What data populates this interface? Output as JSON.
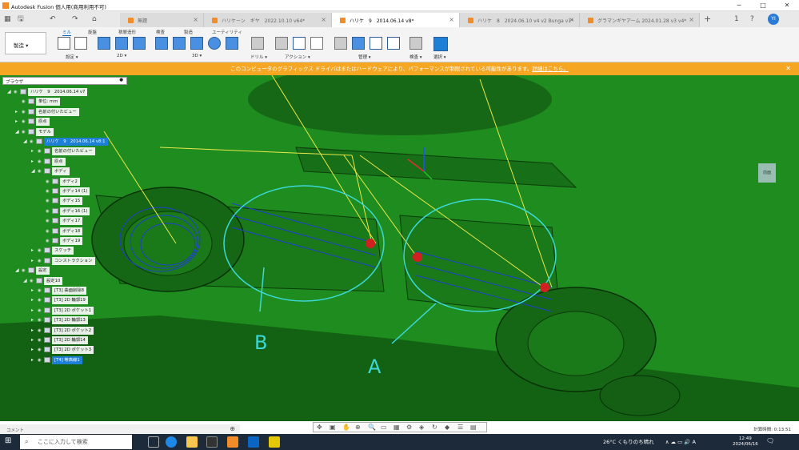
{
  "titlebar": {
    "title": "Autodesk Fusion 個人用(商用利用不可)",
    "minimize": "─",
    "maximize": "□",
    "close": "✕"
  },
  "tabs": [
    {
      "label": "無題"
    },
    {
      "label": "ハリケーン　ギヤ　2022.10.10 v64*"
    },
    {
      "label": "ハリケ　9　2014.06.14 v8*"
    },
    {
      "label": "ハリケ　8　2024.06.10 v4 v2 Bunga v1*"
    },
    {
      "label": "グラマンギヤアーム 2024.01.28 v3 v4*"
    }
  ],
  "tabbar": {
    "grid": "▦",
    "save": "🖫",
    "undo": "↶",
    "redo": "↷",
    "home": "⌂",
    "new_tab": "+",
    "user": "YI",
    "help": "?",
    "notif": "1"
  },
  "toolbar": {
    "workspace": "製造 ▾",
    "tabs": [
      "ミル",
      "旋盤",
      "積層造形",
      "検査",
      "製造",
      "ユーティリティ"
    ],
    "groups": [
      "設定 ▾",
      "2D ▾",
      "3D ▾",
      "ドリル ▾",
      "アクション ▾",
      "管理 ▾",
      "検査 ▾",
      "選択 ▾"
    ]
  },
  "warning": {
    "text": "このコンピュータのグラフィックス ドライバはまたはハードウェアにより、パフォーマンスが制限されている可能性があります。",
    "link": "詳細はこちら。",
    "close": "✕"
  },
  "browser": {
    "header": "ブラウザ",
    "rows": [
      {
        "label": "ハリケ　9　2014.06.14 v7",
        "indent": 0,
        "exp": "◢"
      },
      {
        "label": "単位: mm",
        "indent": 1,
        "exp": ""
      },
      {
        "label": "名前の付いたビュー",
        "indent": 1,
        "exp": "▸"
      },
      {
        "label": "原点",
        "indent": 1,
        "exp": "▸"
      },
      {
        "label": "モデル",
        "indent": 1,
        "exp": "◢"
      },
      {
        "label": "ハリケ　9　2014.06.14 v8:1",
        "indent": 2,
        "exp": "◢",
        "sel": true
      },
      {
        "label": "名前の付いたビュー",
        "indent": 3,
        "exp": "▸"
      },
      {
        "label": "原点",
        "indent": 3,
        "exp": "▸"
      },
      {
        "label": "ボディ",
        "indent": 3,
        "exp": "◢"
      },
      {
        "label": "ボディ2",
        "indent": 4,
        "exp": ""
      },
      {
        "label": "ボディ14 (1)",
        "indent": 4,
        "exp": ""
      },
      {
        "label": "ボディ15",
        "indent": 4,
        "exp": ""
      },
      {
        "label": "ボディ16 (1)",
        "indent": 4,
        "exp": ""
      },
      {
        "label": "ボディ17",
        "indent": 4,
        "exp": ""
      },
      {
        "label": "ボディ18",
        "indent": 4,
        "exp": ""
      },
      {
        "label": "ボディ19",
        "indent": 4,
        "exp": ""
      },
      {
        "label": "スケッチ",
        "indent": 3,
        "exp": "▸"
      },
      {
        "label": "コンストラクション",
        "indent": 3,
        "exp": "▸"
      },
      {
        "label": "設定",
        "indent": 1,
        "exp": "◢"
      },
      {
        "label": "設定10",
        "indent": 2,
        "exp": "◢"
      },
      {
        "label": "[T3] 曲面削除8",
        "indent": 3,
        "exp": "▸"
      },
      {
        "label": "[T3] 2D 輪郭19",
        "indent": 3,
        "exp": "▸"
      },
      {
        "label": "[T3] 2D ポケット1",
        "indent": 3,
        "exp": "▸"
      },
      {
        "label": "[T3] 2D 輪郭13",
        "indent": 3,
        "exp": "▸"
      },
      {
        "label": "[T3] 2D ポケット2",
        "indent": 3,
        "exp": "▸"
      },
      {
        "label": "[T3] 2D 輪郭14",
        "indent": 3,
        "exp": "▸"
      },
      {
        "label": "[T3] 2D ポケット3",
        "indent": 3,
        "exp": "▸"
      },
      {
        "label": "[T4] 等高線1",
        "indent": 3,
        "exp": "▸",
        "sel": true
      }
    ]
  },
  "viewport": {
    "label_a": "A",
    "label_b": "B",
    "cube_label": "前面"
  },
  "navbar": {
    "icons": [
      "✥",
      "▣",
      "✋",
      "⊕",
      "🔍",
      "▭",
      "▦",
      "⚙",
      "◈",
      "↻",
      "◆",
      "☰",
      "▤"
    ]
  },
  "comment": {
    "label": "コメント",
    "add": "⊕"
  },
  "status": {
    "text": "計算時間: 0:13:51"
  },
  "taskbar": {
    "start": "⊞",
    "search": "ここに入力して検索",
    "search_icon": "⌕",
    "weather": "26°C くもりのち晴れ",
    "time": "12:49",
    "date": "2024/06/16",
    "tray": "∧ ☁ ▭ 🔊 A",
    "notifications": "🗨"
  },
  "colors": {
    "brand": "#f28c28",
    "warning": "#f5a623",
    "select": "#1d7fd6",
    "model": "#1f8f1f"
  }
}
